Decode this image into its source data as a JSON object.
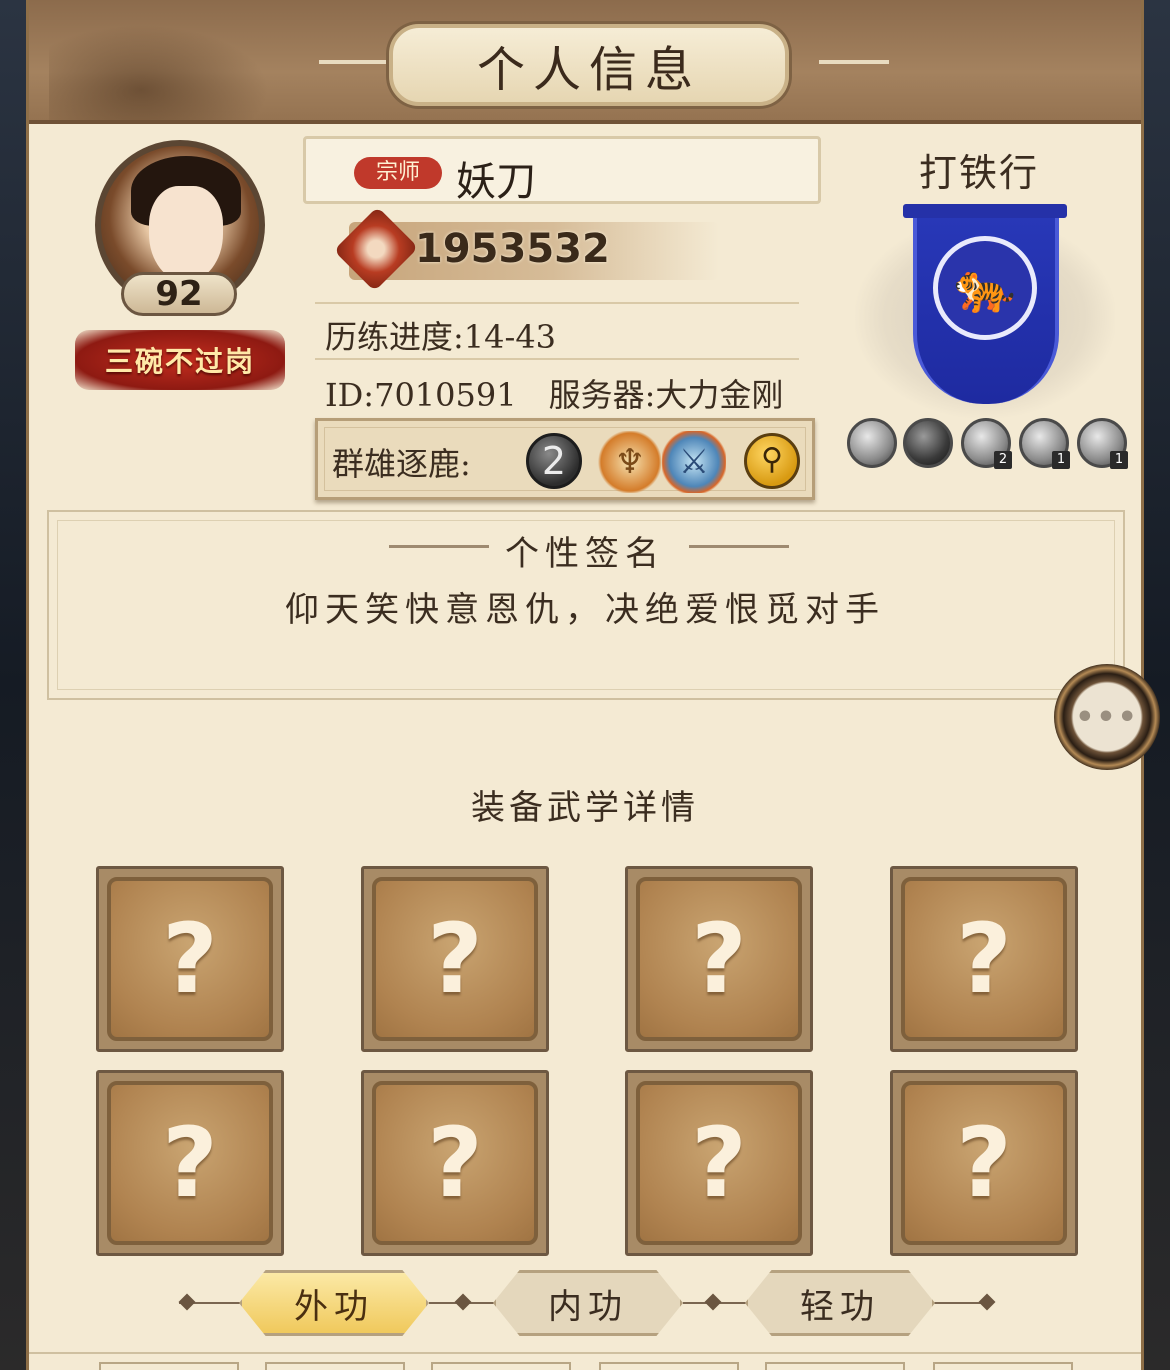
{
  "header": {
    "title": "个人信息"
  },
  "profile": {
    "level": "92",
    "title_badge": "三碗不过岗",
    "rank_tag": "宗师",
    "name": "妖刀",
    "power": "1953532",
    "progress": "历练进度:14-43",
    "id_server": "ID:7010591　服务器:大力金刚",
    "arena_label": "群雄逐鹿:",
    "arena_rank": "2"
  },
  "guild": {
    "name": "打铁行",
    "medals": [
      {
        "icon": "tiger-medal-icon",
        "count": ""
      },
      {
        "icon": "beast-medal-icon",
        "count": ""
      },
      {
        "icon": "tiger-medal-icon",
        "count": "2"
      },
      {
        "icon": "dragon-medal-icon",
        "count": "1"
      },
      {
        "icon": "dragon-medal-icon",
        "count": "1"
      }
    ]
  },
  "signature": {
    "heading": "个性签名",
    "text": "仰天笑快意恩仇，决绝爱恨觅对手"
  },
  "equipment": {
    "heading": "装备武学详情",
    "slots": [
      "?",
      "?",
      "?",
      "?",
      "?",
      "?",
      "?",
      "?"
    ]
  },
  "tabs": [
    "外功",
    "内功",
    "轻功"
  ],
  "chat": {
    "glyph": "•••"
  },
  "colors": {
    "panel": "#f4ead3",
    "header": "#a4825f",
    "guild_banner": "#2838b8",
    "active_tab": "#f0c95c",
    "rank_tag": "#c0392b"
  }
}
